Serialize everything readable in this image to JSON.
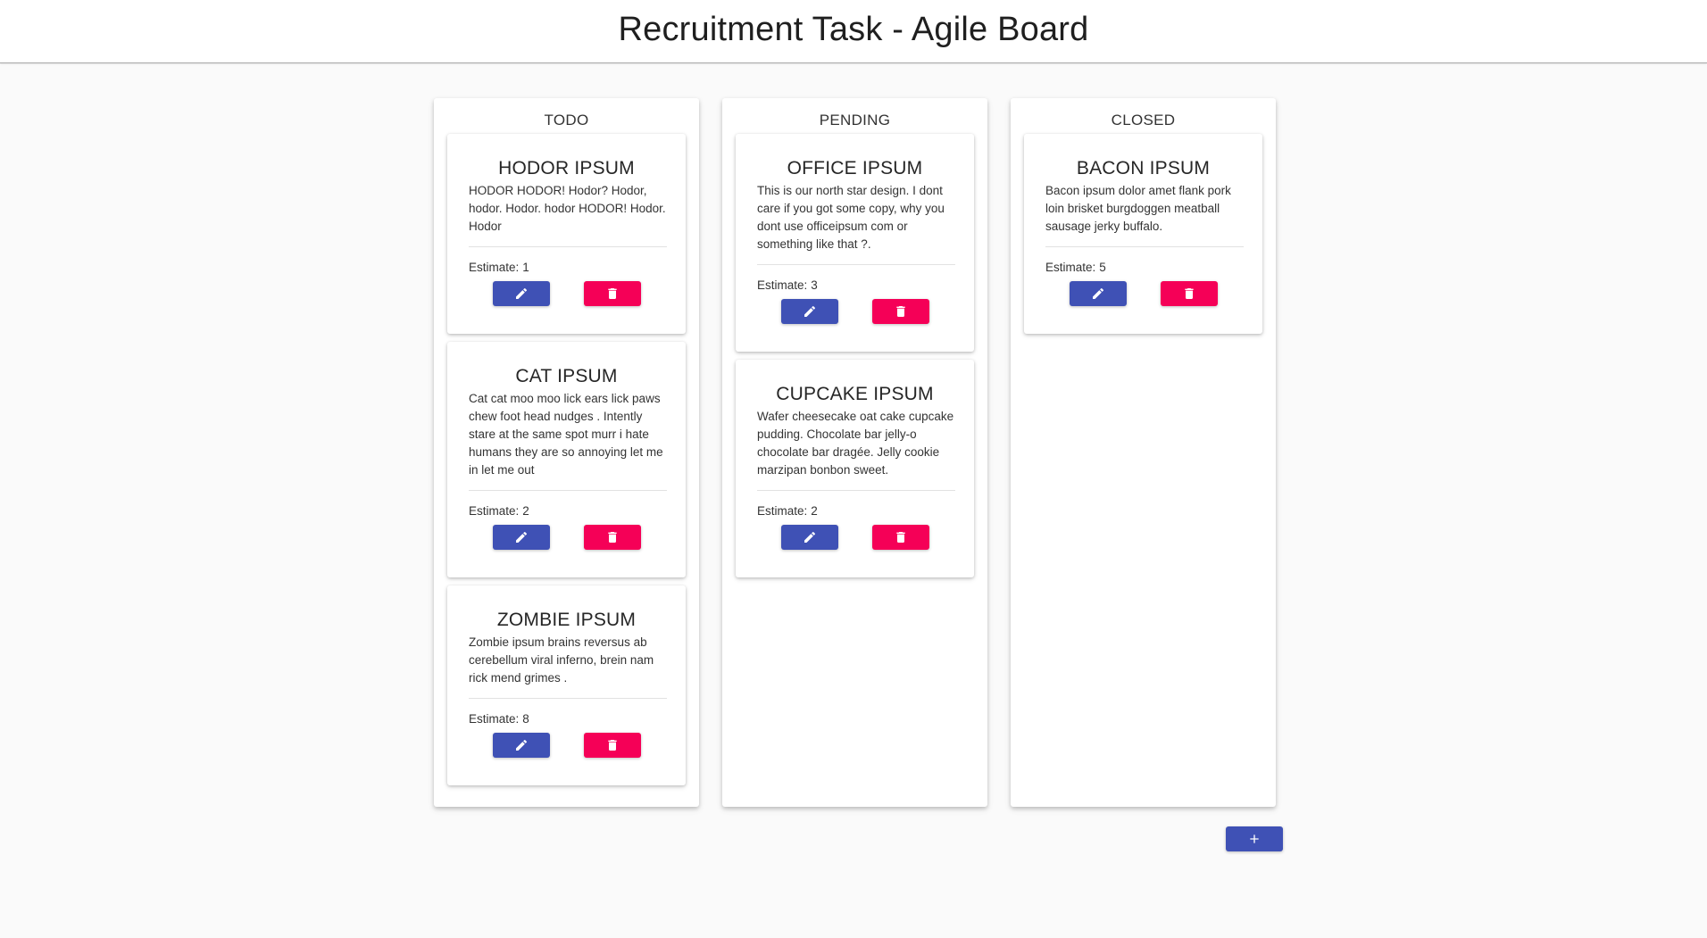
{
  "header": {
    "title": "Recruitment Task - Agile Board"
  },
  "columns": [
    {
      "title": "TODO",
      "cards": [
        {
          "title": "HODOR IPSUM",
          "body": "HODOR HODOR! Hodor? Hodor, hodor. Hodor. hodor HODOR! Hodor. Hodor",
          "estimate_label": "Estimate:",
          "estimate": "1"
        },
        {
          "title": "CAT IPSUM",
          "body": "Cat cat moo moo lick ears lick paws chew foot head nudges . Intently stare at the same spot murr i hate humans they are so annoying let me in let me out",
          "estimate_label": "Estimate:",
          "estimate": "2"
        },
        {
          "title": "ZOMBIE IPSUM",
          "body": "Zombie ipsum brains reversus ab cerebellum viral inferno, brein nam rick mend grimes .",
          "estimate_label": "Estimate:",
          "estimate": "8"
        }
      ]
    },
    {
      "title": "PENDING",
      "cards": [
        {
          "title": "OFFICE IPSUM",
          "body": "This is our north star design. I dont care if you got some copy, why you dont use officeipsum com or something like that ?.",
          "estimate_label": "Estimate:",
          "estimate": "3"
        },
        {
          "title": "CUPCAKE IPSUM",
          "body": "Wafer cheesecake oat cake cupcake pudding. Chocolate bar jelly-o chocolate bar dragée. Jelly cookie marzipan bonbon sweet.",
          "estimate_label": "Estimate:",
          "estimate": "2"
        }
      ]
    },
    {
      "title": "CLOSED",
      "cards": [
        {
          "title": "BACON IPSUM",
          "body": "Bacon ipsum dolor amet flank pork loin brisket burgdoggen meatball sausage jerky buffalo.",
          "estimate_label": "Estimate:",
          "estimate": "5"
        }
      ]
    }
  ],
  "icons": {
    "edit": "pencil-icon",
    "delete": "trash-icon",
    "add": "plus-icon"
  },
  "colors": {
    "primary": "#3f51b5",
    "accent": "#f50057",
    "background": "#fafafa",
    "surface": "#ffffff"
  }
}
